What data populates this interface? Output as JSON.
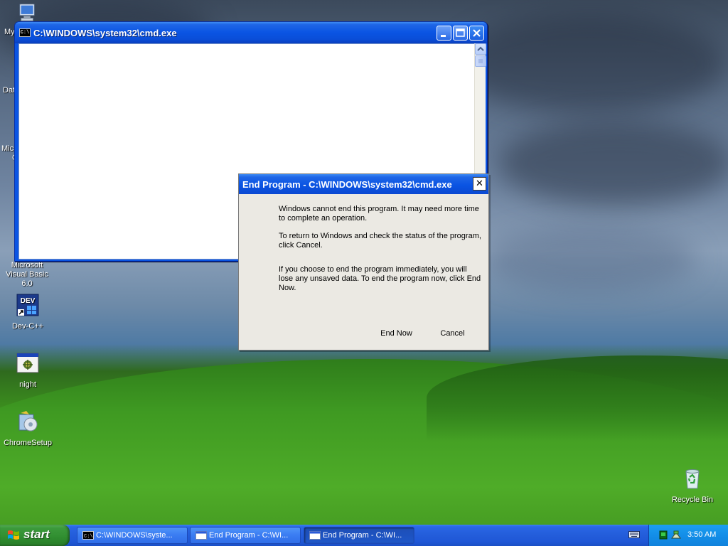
{
  "desktop": {
    "icons": [
      {
        "label": "Microsoft Visual Basic 6.0"
      },
      {
        "label": "Dev-C++"
      },
      {
        "label": "night"
      },
      {
        "label": "ChromeSetup"
      },
      {
        "label": "Recycle Bin"
      }
    ],
    "truncated_labels": [
      "My",
      "Dat",
      "Micro",
      "C"
    ]
  },
  "cmd_window": {
    "title": "C:\\WINDOWS\\system32\\cmd.exe",
    "icon_text": "C:\\"
  },
  "dialog": {
    "title": "End Program - C:\\WINDOWS\\system32\\cmd.exe",
    "close_glyph": "✕",
    "message1": "Windows cannot end this program. It may need more time to complete an operation.",
    "message2": "To return to Windows and check the status of the program, click Cancel.",
    "message3": "If you choose to end the program immediately, you will lose any unsaved data. To end the program now, click End Now.",
    "end_now": "End Now",
    "cancel": "Cancel"
  },
  "taskbar": {
    "start_label": "start",
    "tasks": [
      {
        "label": "C:\\WINDOWS\\syste..."
      },
      {
        "label": "End Program - C:\\WI..."
      },
      {
        "label": "End Program - C:\\WI..."
      }
    ],
    "clock": "3:50 AM"
  },
  "colors": {
    "taskbar_blue": "#245edb",
    "start_green": "#318f31",
    "tray_blue": "#138ee8",
    "title_blue": "#0a54e3",
    "dialog_bg": "#ebe9e3"
  }
}
